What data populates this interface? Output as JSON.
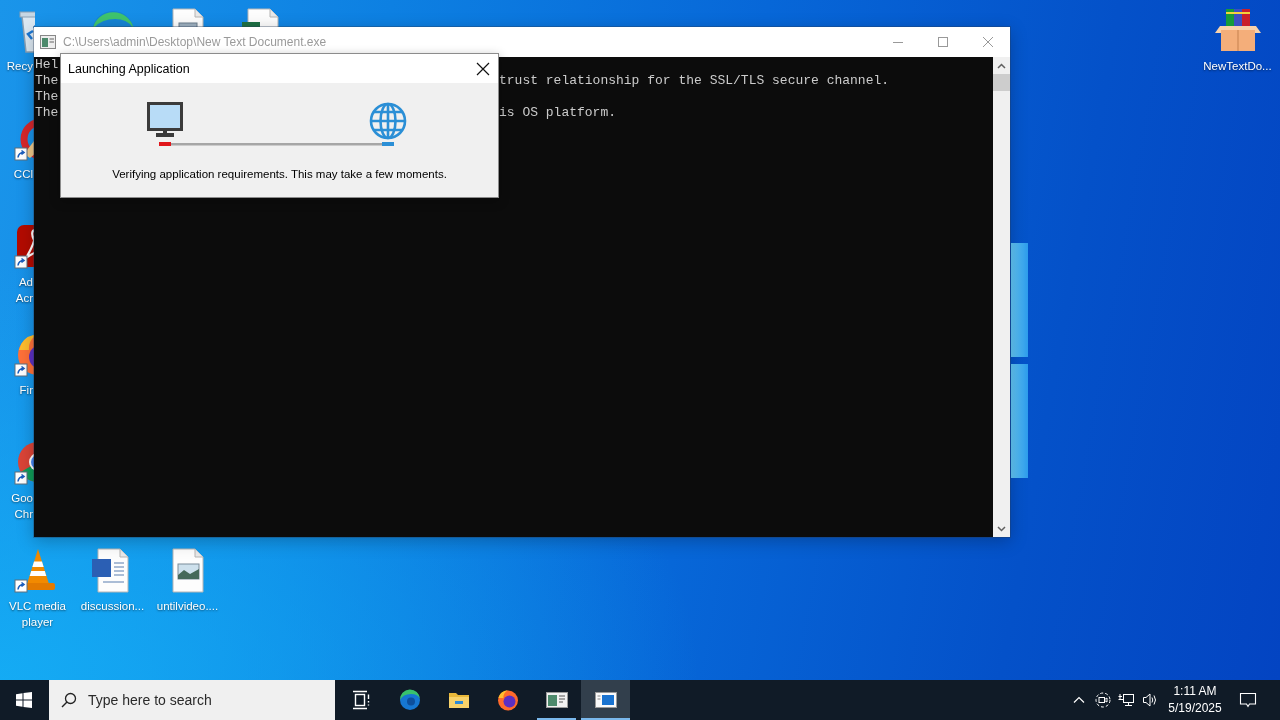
{
  "desktop": {
    "left_column": [
      {
        "kind": "recycle-bin",
        "label": "Recy",
        "shortcut": false,
        "selected": false
      },
      {
        "kind": "ccleaner",
        "label": "CCl",
        "shortcut": true,
        "selected": false
      },
      {
        "kind": "acrobat",
        "label": "Ad Acr",
        "shortcut": true,
        "selected": false
      },
      {
        "kind": "firefox",
        "label": "Fir",
        "shortcut": true,
        "selected": false
      },
      {
        "kind": "chrome",
        "label": "Goo Chr",
        "shortcut": true,
        "selected": false
      },
      {
        "kind": "vlc",
        "label": "VLC media player",
        "shortcut": true,
        "selected": false
      }
    ],
    "top_row": [
      {
        "kind": "edge",
        "selected": false
      },
      {
        "kind": "document",
        "selected": false
      },
      {
        "kind": "spreadsheet",
        "selected": false
      }
    ],
    "bottom_row": [
      {
        "kind": "word-document",
        "label": "discussion...",
        "shortcut": false,
        "selected": false
      },
      {
        "kind": "image-file",
        "label": "untilvideo....",
        "shortcut": false,
        "selected": false
      }
    ],
    "right_column": [
      {
        "kind": "archive",
        "label": "NewTextDo...",
        "shortcut": false,
        "selected": false
      }
    ]
  },
  "console_window": {
    "title": "C:\\Users\\admin\\Desktop\\New Text Document.exe",
    "active": false,
    "lines": [
      {
        "left": "Hel"
      },
      {
        "left": "The",
        "right": "trust relationship for the SSL/TLS secure channel."
      },
      {
        "left": "The"
      },
      {
        "left": "The",
        "right": "is OS platform."
      }
    ]
  },
  "dialog": {
    "title": "Launching Application",
    "message": "Verifying application requirements. This may take a few moments."
  },
  "taskbar": {
    "search": {
      "placeholder": "Type here to search"
    },
    "buttons": [
      {
        "kind": "task-view",
        "running": false,
        "selected": false
      },
      {
        "kind": "edge",
        "running": false,
        "selected": false
      },
      {
        "kind": "file-explorer",
        "running": false,
        "selected": false
      },
      {
        "kind": "firefox",
        "running": false,
        "selected": false
      },
      {
        "kind": "console",
        "running": true,
        "selected": false
      },
      {
        "kind": "installer",
        "running": true,
        "selected": true
      }
    ],
    "tray": {
      "time": "1:11 AM",
      "date": "5/19/2025"
    }
  }
}
